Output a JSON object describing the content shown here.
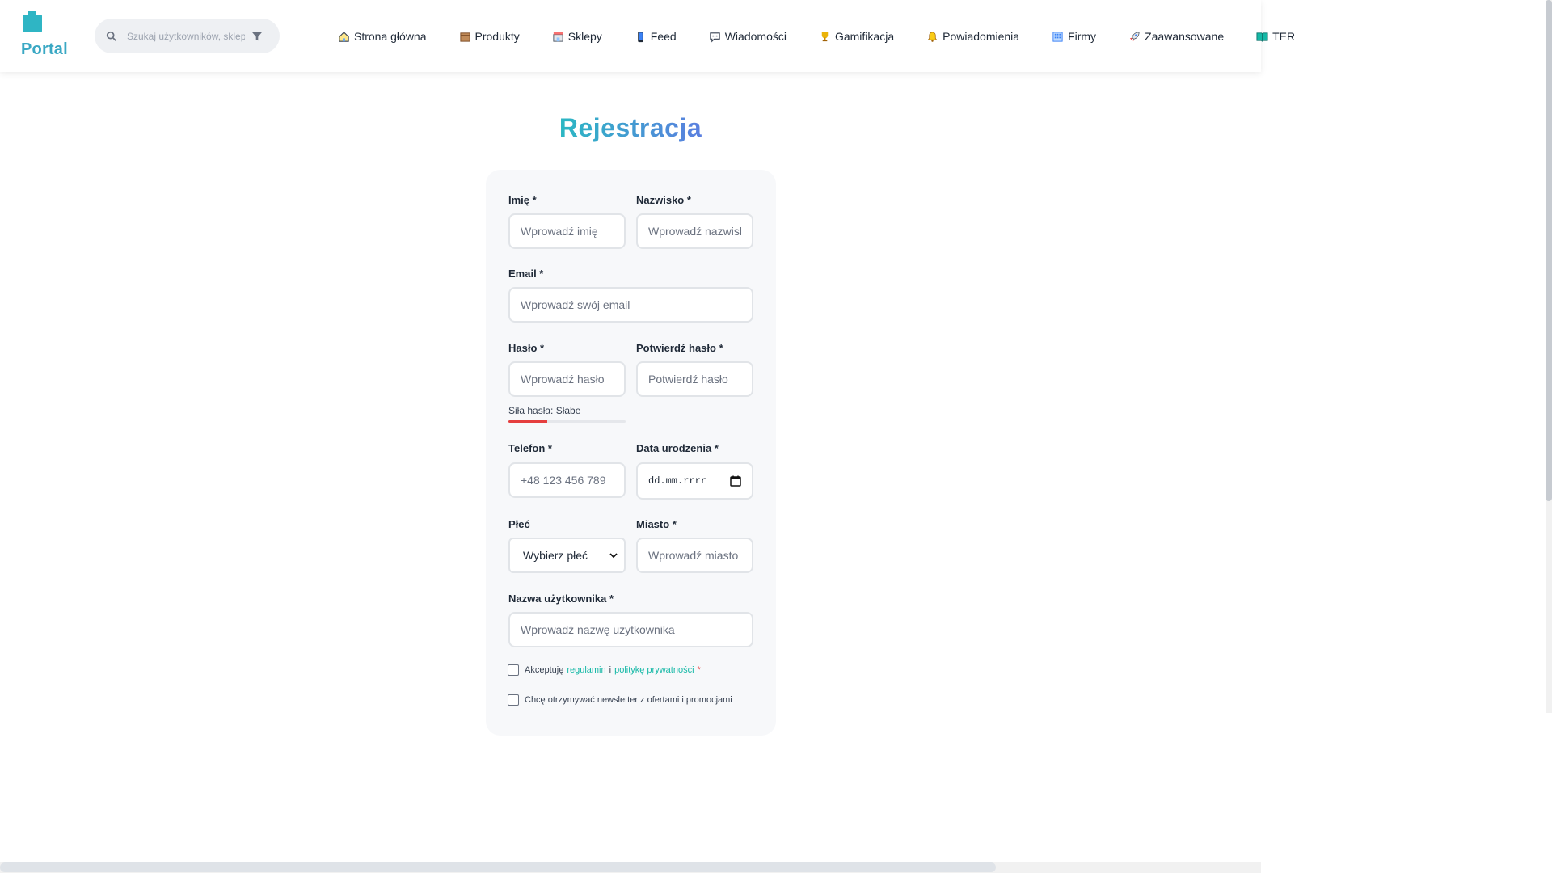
{
  "header": {
    "logo_text": "Portal",
    "search_placeholder": "Szukaj użytkowników, sklep",
    "nav": [
      {
        "label": "Strona główna",
        "icon": "home-icon"
      },
      {
        "label": "Produkty",
        "icon": "box-icon"
      },
      {
        "label": "Sklepy",
        "icon": "store-icon"
      },
      {
        "label": "Feed",
        "icon": "phone-icon"
      },
      {
        "label": "Wiadomości",
        "icon": "chat-icon"
      },
      {
        "label": "Gamifikacja",
        "icon": "trophy-icon"
      },
      {
        "label": "Powiadomienia",
        "icon": "bell-icon"
      },
      {
        "label": "Firmy",
        "icon": "building-icon"
      },
      {
        "label": "Zaawansowane",
        "icon": "rocket-icon"
      },
      {
        "label": "TER",
        "icon": "book-icon"
      }
    ]
  },
  "form": {
    "title": "Rejestracja",
    "first_name": {
      "label": "Imię *",
      "placeholder": "Wprowadź imię"
    },
    "last_name": {
      "label": "Nazwisko *",
      "placeholder": "Wprowadź nazwisko"
    },
    "email": {
      "label": "Email *",
      "placeholder": "Wprowadź swój email"
    },
    "password": {
      "label": "Hasło *",
      "placeholder": "Wprowadź hasło"
    },
    "confirm_password": {
      "label": "Potwierdź hasło *",
      "placeholder": "Potwierdź hasło"
    },
    "strength": {
      "text": "Siła hasła: Słabe",
      "level": 0.33,
      "color": "#e53e3e"
    },
    "phone": {
      "label": "Telefon *",
      "placeholder": "+48 123 456 789"
    },
    "birth_date": {
      "label": "Data urodzenia *",
      "placeholder": "dd.mm.rrrr"
    },
    "gender": {
      "label": "Płeć",
      "selected": "Wybierz płeć"
    },
    "city": {
      "label": "Miasto *",
      "placeholder": "Wprowadź miasto"
    },
    "username": {
      "label": "Nazwa użytkownika *",
      "placeholder": "Wprowadź nazwę użytkownika"
    },
    "terms": {
      "prefix": "Akceptuję",
      "link1": "regulamin",
      "middle": "i",
      "link2": "politykę prywatności",
      "suffix": "*"
    },
    "newsletter": {
      "label": "Chcę otrzymywać newsletter z ofertami i promocjami"
    }
  },
  "colors": {
    "accent": "#14b8a6",
    "title_start": "#2bb7c3",
    "title_end": "#5b7fe0"
  }
}
